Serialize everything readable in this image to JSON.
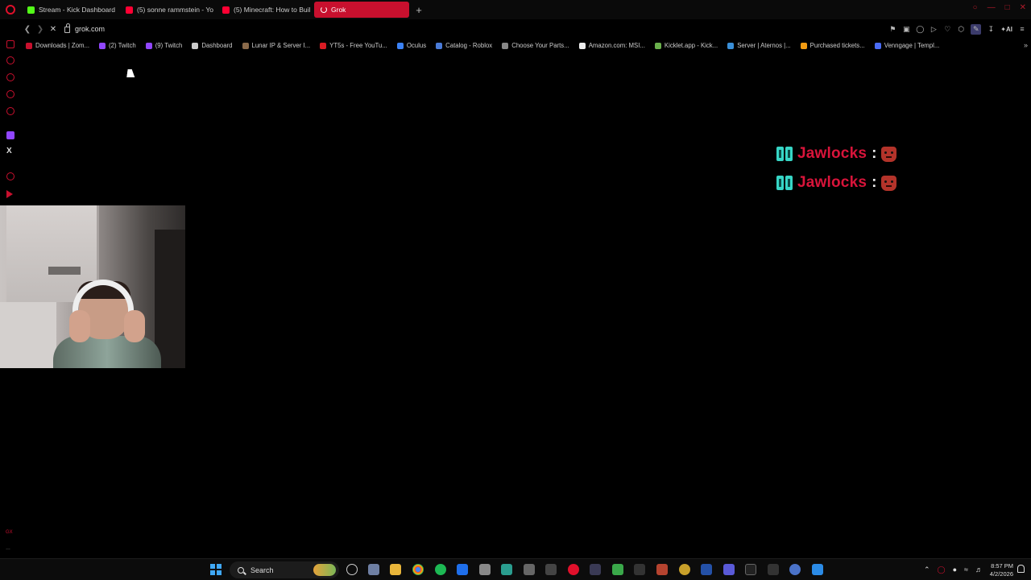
{
  "browser": {
    "tabs": [
      {
        "label": "Stream - Kick Dashboard",
        "color": "#53fc18"
      },
      {
        "label": "(5) sonne rammstein - Yo",
        "color": "#ff0033"
      },
      {
        "label": "(5) Minecraft: How to Buil",
        "color": "#ff0033"
      },
      {
        "label": "Grok",
        "active": true
      }
    ],
    "url": "grok.com",
    "toolbar_ai": "AI"
  },
  "bookmarks": [
    {
      "label": "Downloads | Zom...",
      "color": "#c8102e"
    },
    {
      "label": "(2) Twitch",
      "color": "#9146ff"
    },
    {
      "label": "(9) Twitch",
      "color": "#9146ff"
    },
    {
      "label": "Dashboard",
      "color": "#cccccc"
    },
    {
      "label": "Lunar IP & Server I...",
      "color": "#8a6a4a"
    },
    {
      "label": "YT5s - Free YouTu...",
      "color": "#d81b23"
    },
    {
      "label": "Oculus",
      "color": "#3b82f6"
    },
    {
      "label": "Catalog - Roblox",
      "color": "#4a7bd8"
    },
    {
      "label": "Choose Your Parts...",
      "color": "#888888"
    },
    {
      "label": "Amazon.com: MSI...",
      "color": "#eeeeee"
    },
    {
      "label": "Kicklet.app - Kick...",
      "color": "#6ab04c"
    },
    {
      "label": "Server | Aternos |...",
      "color": "#3a8fd8"
    },
    {
      "label": "Purchased tickets...",
      "color": "#f39c12"
    },
    {
      "label": "Venngage | Templ...",
      "color": "#4a6cf7"
    }
  ],
  "chat": [
    {
      "user": "Jawlocks",
      "sep": ":"
    },
    {
      "user": "Jawlocks",
      "sep": ":"
    }
  ],
  "taskbar": {
    "search_label": "Search",
    "time": "8:57 PM",
    "date": "4/2/2026"
  },
  "colors": {
    "accent": "#c8102e",
    "chat_name": "#d8143a",
    "badge": "#37d6c6"
  }
}
